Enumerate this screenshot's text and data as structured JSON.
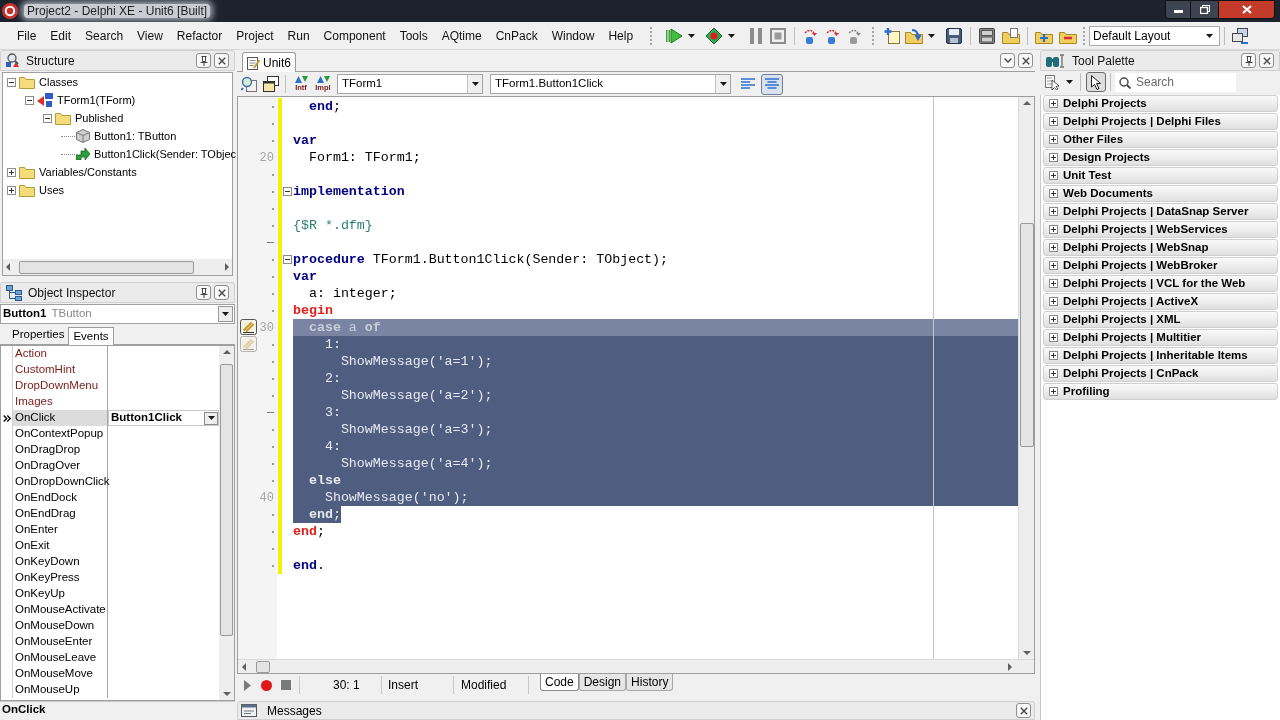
{
  "window": {
    "title": "Project2 - Delphi XE - Unit6 [Built]"
  },
  "menu": [
    "File",
    "Edit",
    "Search",
    "View",
    "Refactor",
    "Project",
    "Run",
    "Component",
    "Tools",
    "AQtime",
    "CnPack",
    "Window",
    "Help"
  ],
  "toolbar": {
    "layout": "Default Layout"
  },
  "structure": {
    "title": "Structure",
    "tree": [
      {
        "label": "Classes",
        "kind": "folder",
        "expanded": true,
        "children": [
          {
            "label": "TForm1(TForm)",
            "kind": "class",
            "expanded": true,
            "children": [
              {
                "label": "Published",
                "kind": "folder",
                "expanded": true,
                "children": [
                  {
                    "label": "Button1: TButton",
                    "kind": "field"
                  },
                  {
                    "label": "Button1Click(Sender: TObjec",
                    "kind": "method"
                  }
                ]
              }
            ]
          }
        ]
      },
      {
        "label": "Variables/Constants",
        "kind": "folder",
        "expanded": false
      },
      {
        "label": "Uses",
        "kind": "folder",
        "expanded": false
      }
    ]
  },
  "object_inspector": {
    "title": "Object Inspector",
    "object_name": "Button1",
    "object_type": "TButton",
    "tabs": [
      {
        "label": "Properties",
        "selected": false
      },
      {
        "label": "Events",
        "selected": true
      }
    ],
    "rows": [
      {
        "name": "Action",
        "kind": "reference",
        "selected": false
      },
      {
        "name": "CustomHint",
        "kind": "reference",
        "selected": false
      },
      {
        "name": "DropDownMenu",
        "kind": "reference",
        "selected": false
      },
      {
        "name": "Images",
        "kind": "reference",
        "selected": false
      },
      {
        "name": "OnClick",
        "kind": "event",
        "selected": true,
        "value": "Button1Click"
      },
      {
        "name": "OnContextPopup",
        "kind": "event",
        "selected": false
      },
      {
        "name": "OnDragDrop",
        "kind": "event",
        "selected": false
      },
      {
        "name": "OnDragOver",
        "kind": "event",
        "selected": false
      },
      {
        "name": "OnDropDownClick",
        "kind": "event",
        "selected": false
      },
      {
        "name": "OnEndDock",
        "kind": "event",
        "selected": false
      },
      {
        "name": "OnEndDrag",
        "kind": "event",
        "selected": false
      },
      {
        "name": "OnEnter",
        "kind": "event",
        "selected": false
      },
      {
        "name": "OnExit",
        "kind": "event",
        "selected": false
      },
      {
        "name": "OnKeyDown",
        "kind": "event",
        "selected": false
      },
      {
        "name": "OnKeyPress",
        "kind": "event",
        "selected": false
      },
      {
        "name": "OnKeyUp",
        "kind": "event",
        "selected": false
      },
      {
        "name": "OnMouseActivate",
        "kind": "event",
        "selected": false
      },
      {
        "name": "OnMouseDown",
        "kind": "event",
        "selected": false
      },
      {
        "name": "OnMouseEnter",
        "kind": "event",
        "selected": false
      },
      {
        "name": "OnMouseLeave",
        "kind": "event",
        "selected": false
      },
      {
        "name": "OnMouseMove",
        "kind": "event",
        "selected": false
      },
      {
        "name": "OnMouseUp",
        "kind": "event",
        "selected": false
      }
    ],
    "status": "OnClick"
  },
  "editor": {
    "tabs": [
      {
        "label": "Unit6",
        "selected": true
      }
    ],
    "interface_button": "Intf",
    "implementation_button": "Impl",
    "class_combo": "TForm1",
    "method_combo": "TForm1.Button1Click",
    "align_buttons": [
      {
        "pressed": false
      },
      {
        "pressed": true
      }
    ],
    "lines": [
      {
        "gutter": {
          "kind": "dot"
        },
        "modified": true,
        "selected": false,
        "current": false,
        "tokens": [
          {
            "text": "  end",
            "kind": "keyword"
          },
          {
            "text": ";",
            "kind": "plain"
          }
        ]
      },
      {
        "gutter": {
          "kind": "dot"
        },
        "modified": true,
        "selected": false,
        "current": false
      },
      {
        "gutter": {
          "kind": "dot"
        },
        "modified": true,
        "selected": false,
        "current": false,
        "tokens": [
          {
            "text": "var",
            "kind": "keyword"
          }
        ]
      },
      {
        "gutter": {
          "kind": "number",
          "text": "20"
        },
        "modified": true,
        "selected": false,
        "current": false,
        "tokens": [
          {
            "text": "  Form1: TForm1;",
            "kind": "plain"
          }
        ]
      },
      {
        "gutter": {
          "kind": "dot"
        },
        "modified": true,
        "selected": false,
        "current": false
      },
      {
        "gutter": {
          "kind": "dot"
        },
        "modified": true,
        "folded": false,
        "selected": false,
        "current": false,
        "tokens": [
          {
            "text": "implementation",
            "kind": "keyword"
          }
        ]
      },
      {
        "gutter": {
          "kind": "dot"
        },
        "modified": true,
        "selected": false,
        "current": false
      },
      {
        "gutter": {
          "kind": "dot"
        },
        "modified": true,
        "selected": false,
        "current": false,
        "tokens": [
          {
            "text": "{$R *.dfm}",
            "kind": "directive"
          }
        ]
      },
      {
        "gutter": {
          "kind": "dash"
        },
        "modified": true,
        "selected": false,
        "current": false
      },
      {
        "gutter": {
          "kind": "dot"
        },
        "modified": true,
        "folded": false,
        "selected": false,
        "current": false,
        "tokens": [
          {
            "text": "procedure",
            "kind": "keyword"
          },
          {
            "text": " TForm1.Button1Click(Sender: TObject);",
            "kind": "plain"
          }
        ]
      },
      {
        "gutter": {
          "kind": "dot"
        },
        "modified": true,
        "selected": false,
        "current": false,
        "tokens": [
          {
            "text": "var",
            "kind": "keyword"
          }
        ]
      },
      {
        "gutter": {
          "kind": "dot"
        },
        "modified": true,
        "selected": false,
        "current": false,
        "tokens": [
          {
            "text": "  a: integer;",
            "kind": "plain"
          }
        ]
      },
      {
        "gutter": {
          "kind": "dot"
        },
        "modified": true,
        "selected": false,
        "current": false,
        "tokens": [
          {
            "text": "begin",
            "kind": "match"
          }
        ]
      },
      {
        "gutter": {
          "kind": "number",
          "text": "30"
        },
        "modified": true,
        "selected": true,
        "full_width": true,
        "current": true,
        "tokens": [
          {
            "text": "  case",
            "kind": "keyword"
          },
          {
            "text": " a ",
            "kind": "plain"
          },
          {
            "text": "of",
            "kind": "keyword"
          }
        ]
      },
      {
        "gutter": {
          "kind": "dot"
        },
        "modified": true,
        "selected": true,
        "full_width": true,
        "current": false,
        "tokens": [
          {
            "text": "    1:",
            "kind": "plain"
          }
        ]
      },
      {
        "gutter": {
          "kind": "dot"
        },
        "modified": true,
        "selected": true,
        "full_width": true,
        "current": false,
        "tokens": [
          {
            "text": "      ShowMessage('a=1');",
            "kind": "plain"
          }
        ]
      },
      {
        "gutter": {
          "kind": "dot"
        },
        "modified": true,
        "selected": true,
        "full_width": true,
        "current": false,
        "tokens": [
          {
            "text": "    2:",
            "kind": "plain"
          }
        ]
      },
      {
        "gutter": {
          "kind": "dot"
        },
        "modified": true,
        "selected": true,
        "full_width": true,
        "current": false,
        "tokens": [
          {
            "text": "      ShowMessage('a=2');",
            "kind": "plain"
          }
        ]
      },
      {
        "gutter": {
          "kind": "dash"
        },
        "modified": true,
        "selected": true,
        "full_width": true,
        "current": false,
        "tokens": [
          {
            "text": "    3:",
            "kind": "plain"
          }
        ]
      },
      {
        "gutter": {
          "kind": "dot"
        },
        "modified": true,
        "selected": true,
        "full_width": true,
        "current": false,
        "tokens": [
          {
            "text": "      ShowMessage('a=3');",
            "kind": "plain"
          }
        ]
      },
      {
        "gutter": {
          "kind": "dot"
        },
        "modified": true,
        "selected": true,
        "full_width": true,
        "current": false,
        "tokens": [
          {
            "text": "    4:",
            "kind": "plain"
          }
        ]
      },
      {
        "gutter": {
          "kind": "dot"
        },
        "modified": true,
        "selected": true,
        "full_width": true,
        "current": false,
        "tokens": [
          {
            "text": "      ShowMessage('a=4');",
            "kind": "plain"
          }
        ]
      },
      {
        "gutter": {
          "kind": "dot"
        },
        "modified": true,
        "selected": true,
        "full_width": true,
        "current": false,
        "tokens": [
          {
            "text": "  else",
            "kind": "keyword"
          }
        ]
      },
      {
        "gutter": {
          "kind": "number",
          "text": "40"
        },
        "modified": true,
        "selected": true,
        "full_width": true,
        "current": false,
        "tokens": [
          {
            "text": "    ShowMessage('no');",
            "kind": "plain"
          }
        ]
      },
      {
        "gutter": {
          "kind": "dot"
        },
        "modified": true,
        "selected": true,
        "full_width": false,
        "current": false,
        "tokens": [
          {
            "text": "  end",
            "kind": "keyword"
          },
          {
            "text": ";",
            "kind": "plain"
          }
        ]
      },
      {
        "gutter": {
          "kind": "dot"
        },
        "modified": true,
        "selected": false,
        "current": false,
        "tokens": [
          {
            "text": "end",
            "kind": "match"
          },
          {
            "text": ";",
            "kind": "plain"
          }
        ]
      },
      {
        "gutter": {
          "kind": "dot"
        },
        "modified": true,
        "selected": false,
        "current": false
      },
      {
        "gutter": {
          "kind": "dot"
        },
        "modified": true,
        "selected": false,
        "current": false,
        "tokens": [
          {
            "text": "end",
            "kind": "keyword"
          },
          {
            "text": ".",
            "kind": "plain"
          }
        ]
      }
    ],
    "status": {
      "position": "30: 1",
      "mode": "Insert",
      "state": "Modified"
    },
    "view_tabs": [
      {
        "label": "Code",
        "selected": true
      },
      {
        "label": "Design",
        "selected": false
      },
      {
        "label": "History",
        "selected": false
      }
    ]
  },
  "messages": {
    "title": "Messages"
  },
  "tool_palette": {
    "title": "Tool Palette",
    "pointer_pressed": true,
    "search": {
      "placeholder": "Search"
    },
    "categories": [
      {
        "label": "Delphi Projects",
        "expanded": false
      },
      {
        "label": "Delphi Projects | Delphi Files",
        "expanded": false
      },
      {
        "label": "Other Files",
        "expanded": false
      },
      {
        "label": "Design Projects",
        "expanded": false
      },
      {
        "label": "Unit Test",
        "expanded": false
      },
      {
        "label": "Web Documents",
        "expanded": false
      },
      {
        "label": "Delphi Projects | DataSnap Server",
        "expanded": false
      },
      {
        "label": "Delphi Projects | WebServices",
        "expanded": false
      },
      {
        "label": "Delphi Projects | WebSnap",
        "expanded": false
      },
      {
        "label": "Delphi Projects | WebBroker",
        "expanded": false
      },
      {
        "label": "Delphi Projects | VCL for the Web",
        "expanded": false
      },
      {
        "label": "Delphi Projects | ActiveX",
        "expanded": false
      },
      {
        "label": "Delphi Projects | XML",
        "expanded": false
      },
      {
        "label": "Delphi Projects | Multitier",
        "expanded": false
      },
      {
        "label": "Delphi Projects | Inheritable Items",
        "expanded": false
      },
      {
        "label": "Delphi Projects | CnPack",
        "expanded": false
      },
      {
        "label": "Profiling",
        "expanded": false
      }
    ]
  }
}
